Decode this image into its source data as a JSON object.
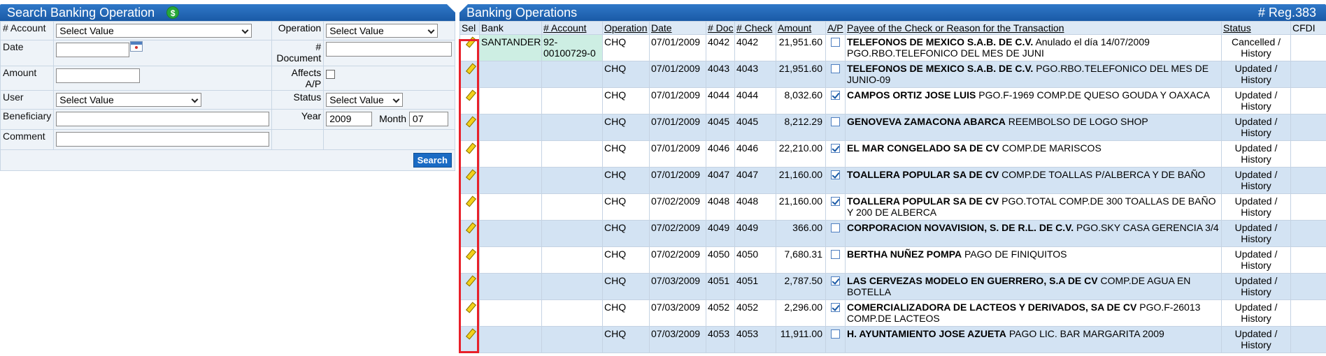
{
  "search": {
    "title": "Search Banking Operation",
    "labels": {
      "account": "# Account",
      "operation": "Operation",
      "date": "Date",
      "document": "# Document",
      "amount": "Amount",
      "affects": "Affects A/P",
      "user": "User",
      "status": "Status",
      "beneficiary": "Beneficiary",
      "year": "Year",
      "month": "Month",
      "comment": "Comment"
    },
    "account_select": "Select Value",
    "operation_select": "Select Value",
    "user_select": "Select Value",
    "status_select": "Select Value",
    "year_value": "2009",
    "month_value": "07",
    "search_button": "Search"
  },
  "ops": {
    "title": "Banking Operations",
    "reg_count": "# Reg.383",
    "columns": [
      "Sel",
      "Bank",
      "# Account",
      "Operation",
      "Date",
      "# Doc",
      "# Check",
      "Amount",
      "A/P",
      "Payee of the Check or Reason for the Transaction",
      "Status",
      "CFDI"
    ],
    "rows": [
      {
        "bank": "SANTANDER",
        "account": "92-00100729-0",
        "operation": "CHQ",
        "date": "07/01/2009",
        "doc": "4042",
        "check": "4042",
        "amount": "21,951.60",
        "ap": false,
        "payee": "TELEFONOS DE MEXICO S.A.B. DE C.V.",
        "reason": "Anulado el día 14/07/2009 PGO.RBO.TELEFONICO DEL MES DE JUNI",
        "status": "Cancelled / History"
      },
      {
        "bank": "",
        "account": "",
        "operation": "CHQ",
        "date": "07/01/2009",
        "doc": "4043",
        "check": "4043",
        "amount": "21,951.60",
        "ap": false,
        "payee": "TELEFONOS DE MEXICO S.A.B. DE C.V.",
        "reason": "PGO.RBO.TELEFONICO DEL MES DE JUNIO-09",
        "status": "Updated / History"
      },
      {
        "bank": "",
        "account": "",
        "operation": "CHQ",
        "date": "07/01/2009",
        "doc": "4044",
        "check": "4044",
        "amount": "8,032.60",
        "ap": true,
        "payee": "CAMPOS ORTIZ JOSE LUIS",
        "reason": "PGO.F-1969 COMP.DE QUESO GOUDA Y OAXACA",
        "status": "Updated / History"
      },
      {
        "bank": "",
        "account": "",
        "operation": "CHQ",
        "date": "07/01/2009",
        "doc": "4045",
        "check": "4045",
        "amount": "8,212.29",
        "ap": false,
        "payee": "GENOVEVA ZAMACONA ABARCA",
        "reason": "REEMBOLSO DE LOGO SHOP",
        "status": "Updated / History"
      },
      {
        "bank": "",
        "account": "",
        "operation": "CHQ",
        "date": "07/01/2009",
        "doc": "4046",
        "check": "4046",
        "amount": "22,210.00",
        "ap": true,
        "payee": "EL MAR CONGELADO SA DE CV",
        "reason": "COMP.DE MARISCOS",
        "status": "Updated / History"
      },
      {
        "bank": "",
        "account": "",
        "operation": "CHQ",
        "date": "07/01/2009",
        "doc": "4047",
        "check": "4047",
        "amount": "21,160.00",
        "ap": true,
        "payee": "TOALLERA POPULAR SA DE CV",
        "reason": "COMP.DE TOALLAS P/ALBERCA Y DE BAÑO",
        "status": "Updated / History"
      },
      {
        "bank": "",
        "account": "",
        "operation": "CHQ",
        "date": "07/02/2009",
        "doc": "4048",
        "check": "4048",
        "amount": "21,160.00",
        "ap": true,
        "payee": "TOALLERA POPULAR SA DE CV",
        "reason": "PGO.TOTAL COMP.DE 300 TOALLAS DE BAÑO Y 200 DE ALBERCA",
        "status": "Updated / History"
      },
      {
        "bank": "",
        "account": "",
        "operation": "CHQ",
        "date": "07/02/2009",
        "doc": "4049",
        "check": "4049",
        "amount": "366.00",
        "ap": false,
        "payee": "CORPORACION NOVAVISION, S. DE R.L. DE C.V.",
        "reason": "PGO.SKY CASA GERENCIA 3/4",
        "status": "Updated / History"
      },
      {
        "bank": "",
        "account": "",
        "operation": "CHQ",
        "date": "07/02/2009",
        "doc": "4050",
        "check": "4050",
        "amount": "7,680.31",
        "ap": false,
        "payee": "BERTHA NUÑEZ POMPA",
        "reason": "PAGO DE FINIQUITOS",
        "status": "Updated / History"
      },
      {
        "bank": "",
        "account": "",
        "operation": "CHQ",
        "date": "07/03/2009",
        "doc": "4051",
        "check": "4051",
        "amount": "2,787.50",
        "ap": true,
        "payee": "LAS CERVEZAS MODELO EN GUERRERO, S.A DE CV",
        "reason": "COMP.DE AGUA EN BOTELLA",
        "status": "Updated / History"
      },
      {
        "bank": "",
        "account": "",
        "operation": "CHQ",
        "date": "07/03/2009",
        "doc": "4052",
        "check": "4052",
        "amount": "2,296.00",
        "ap": true,
        "payee": "COMERCIALIZADORA DE LACTEOS Y DERIVADOS, SA DE CV",
        "reason": "PGO.F-26013 COMP.DE LACTEOS",
        "status": "Updated / History"
      },
      {
        "bank": "",
        "account": "",
        "operation": "CHQ",
        "date": "07/03/2009",
        "doc": "4053",
        "check": "4053",
        "amount": "11,911.00",
        "ap": false,
        "payee": "H. AYUNTAMIENTO JOSE AZUETA",
        "reason": "PAGO LIC. BAR MARGARITA 2009",
        "status": "Updated / History"
      }
    ]
  },
  "colors": {
    "title_bar": "#1a5aa6",
    "row_alt": "#d3e3f3",
    "highlight": "#e8202a",
    "bank_cell": "#cdeee3"
  }
}
